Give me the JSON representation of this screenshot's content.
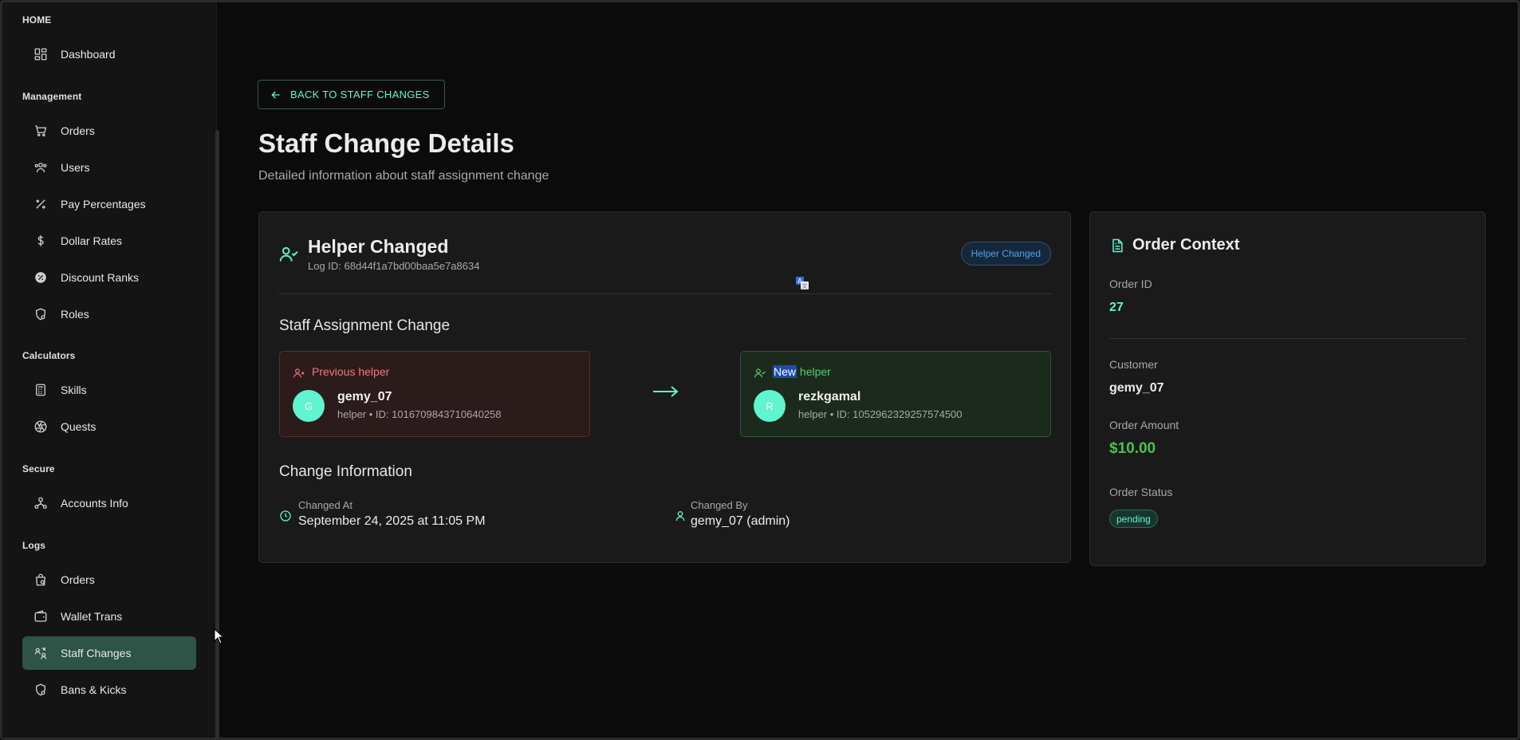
{
  "sidebar": {
    "sections": {
      "home": "HOME",
      "management": "Management",
      "calculators": "Calculators",
      "secure": "Secure",
      "logs": "Logs"
    },
    "items": {
      "dashboard": "Dashboard",
      "orders": "Orders",
      "users": "Users",
      "pay_percentages": "Pay Percentages",
      "dollar_rates": "Dollar Rates",
      "discount_ranks": "Discount Ranks",
      "roles": "Roles",
      "skills": "Skills",
      "quests": "Quests",
      "accounts_info": "Accounts Info",
      "logs_orders": "Orders",
      "wallet_trans": "Wallet Trans",
      "staff_changes": "Staff Changes",
      "bans_kicks": "Bans & Kicks"
    },
    "active_item": "Staff Changes"
  },
  "main": {
    "back_label": "BACK TO STAFF CHANGES",
    "title": "Staff Change Details",
    "subtitle": "Detailed information about staff assignment change",
    "card": {
      "title": "Helper Changed",
      "log_id": "Log ID: 68d44f1a7bd00baa5e7a8634",
      "badge": "Helper Changed",
      "assignment_heading": "Staff Assignment Change",
      "previous": {
        "tag": "Previous helper",
        "initial": "G",
        "name": "gemy_07",
        "meta": "helper • ID: 1016709843710640258"
      },
      "new": {
        "tag_highlight": "New",
        "tag_rest": " helper",
        "initial": "R",
        "name": "rezkgamal",
        "meta": "helper • ID: 1052962329257574500"
      },
      "info_heading": "Change Information",
      "changed_at_label": "Changed At",
      "changed_at_value": "September 24, 2025 at 11:05 PM",
      "changed_by_label": "Changed By",
      "changed_by_value": "gemy_07 (admin)"
    },
    "order_context": {
      "title": "Order Context",
      "order_id_label": "Order ID",
      "order_id_value": "27",
      "customer_label": "Customer",
      "customer_value": "gemy_07",
      "amount_label": "Order Amount",
      "amount_value": "$10.00",
      "status_label": "Order Status",
      "status_value": "pending"
    }
  },
  "colors": {
    "accent": "#5ff5cf",
    "active_nav": "#2d5446",
    "previous_red": "#f07a7a",
    "new_green": "#59cf6b",
    "amount_green": "#4cc04f",
    "badge_blue": "#4da3f5"
  }
}
